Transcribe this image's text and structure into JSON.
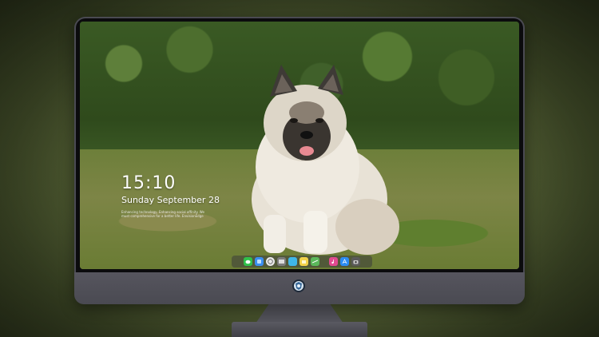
{
  "lock_screen": {
    "time": "15:10",
    "date": "Sunday September 28",
    "note_line1": "Enhancing technology, Enhancing social affinity. We",
    "note_line2": "must comprehensive for a better life. EnvisionEdge"
  },
  "dock": {
    "items": [
      {
        "name": "messages-icon",
        "color": "#2fc24a"
      },
      {
        "name": "finder-icon",
        "color": "#3a8ef0"
      },
      {
        "name": "safari-icon",
        "color": "#e9e9e9"
      },
      {
        "name": "video-icon",
        "color": "#7c7c7c"
      },
      {
        "name": "photos-icon",
        "color": "#3fb7e8"
      },
      {
        "name": "notes-icon",
        "color": "#f2d24a"
      },
      {
        "name": "maps-icon",
        "color": "#5bb85a"
      },
      {
        "name": "music-icon",
        "color": "#e24a8f"
      },
      {
        "name": "app-store-icon",
        "color": "#2b8cf2"
      },
      {
        "name": "camera-icon",
        "color": "#5a5a5a"
      }
    ]
  },
  "monitor": {
    "logo": "monitor-brand-logo-icon"
  }
}
